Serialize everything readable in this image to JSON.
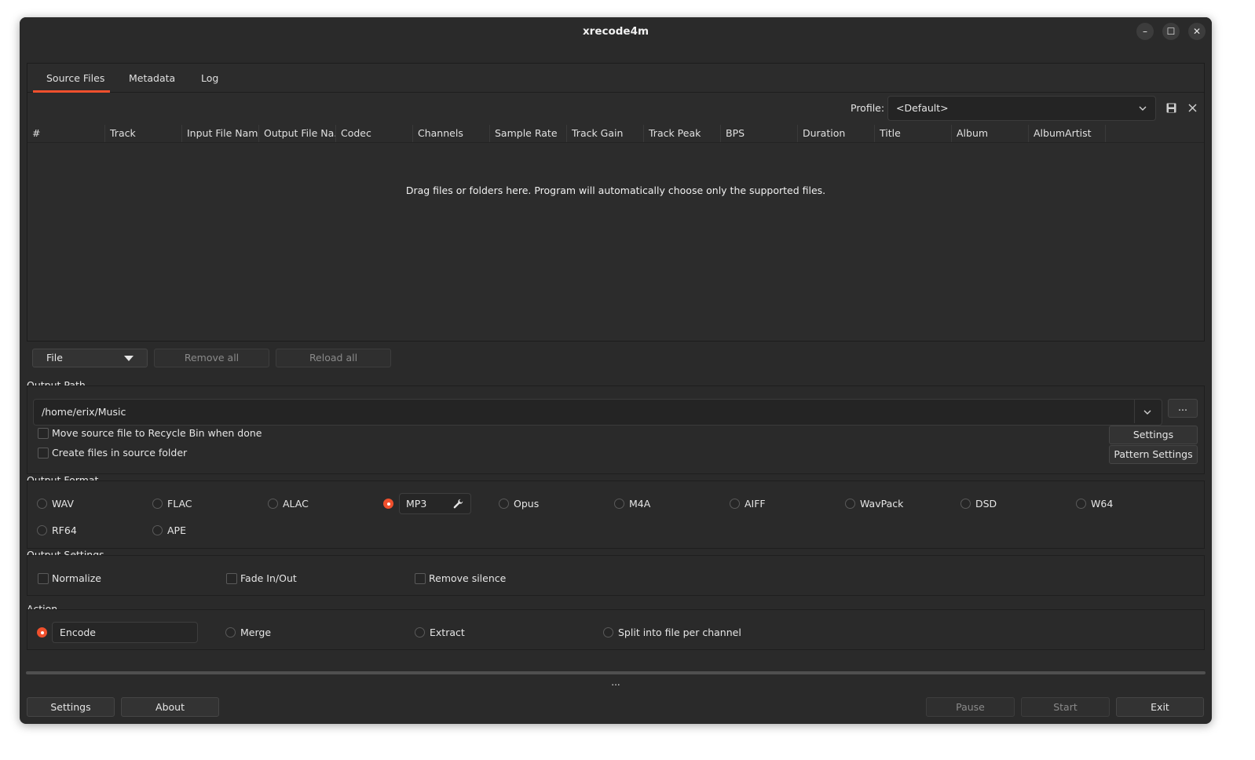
{
  "window": {
    "title": "xrecode4m",
    "minimize_label": "–",
    "maximize_label": "☐",
    "close_label": "✕"
  },
  "tabs": [
    {
      "label": "Source Files",
      "active": true
    },
    {
      "label": "Metadata",
      "active": false
    },
    {
      "label": "Log",
      "active": false
    }
  ],
  "profile": {
    "label": "Profile:",
    "value": "<Default>",
    "save_icon": "save-icon",
    "clear_icon": "close-icon"
  },
  "table": {
    "columns": [
      "#",
      "Track",
      "Input File Name",
      "Output File Na...",
      "Codec",
      "Channels",
      "Sample Rate",
      "Track Gain",
      "Track Peak",
      "BPS",
      "Duration",
      "Title",
      "Album",
      "AlbumArtist"
    ],
    "empty_text": "Drag files or folders here. Program will automatically choose only the supported files."
  },
  "file_buttons": {
    "file": "File",
    "remove_all": "Remove all",
    "reload_all": "Reload all"
  },
  "output_path": {
    "section": "Output Path",
    "value": "/home/erix/Music",
    "browse": "...",
    "move_source": "Move source file to Recycle Bin when done",
    "create_in_source": "Create files in source folder",
    "settings": "Settings",
    "pattern_settings": "Pattern Settings"
  },
  "output_format": {
    "section": "Output Format",
    "formats": [
      "WAV",
      "FLAC",
      "ALAC",
      "MP3",
      "Opus",
      "M4A",
      "AIFF",
      "WavPack",
      "DSD",
      "W64",
      "RF64",
      "APE"
    ],
    "selected": "MP3",
    "tool_icon": "wrench-icon"
  },
  "output_settings": {
    "section": "Output Settings",
    "normalize": "Normalize",
    "fade": "Fade In/Out",
    "remove_silence": "Remove silence"
  },
  "action": {
    "section": "Action",
    "encode": "Encode",
    "merge": "Merge",
    "extract": "Extract",
    "split": "Split into file per channel",
    "selected": "Encode"
  },
  "progress": {
    "value": 0,
    "status": "..."
  },
  "bottom": {
    "settings": "Settings",
    "about": "About",
    "pause": "Pause",
    "start": "Start",
    "exit": "Exit"
  },
  "colors": {
    "accent": "#f0502d",
    "background": "#2a2a2a"
  }
}
